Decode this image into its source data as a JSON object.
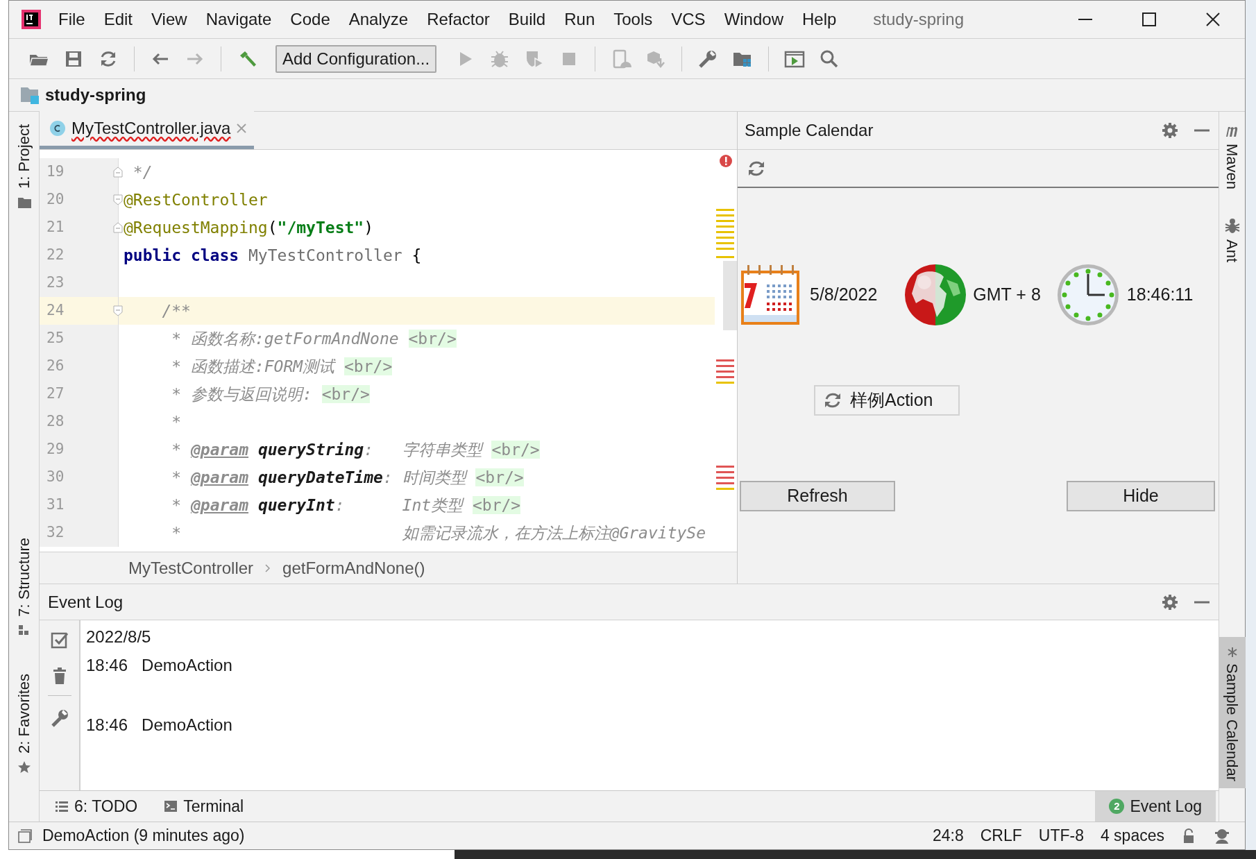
{
  "title_bar": {
    "menu": [
      "File",
      "Edit",
      "View",
      "Navigate",
      "Code",
      "Analyze",
      "Refactor",
      "Build",
      "Run",
      "Tools",
      "VCS",
      "Window",
      "Help"
    ],
    "title": "study-spring"
  },
  "toolbar": {
    "file_buttons": [
      {
        "disabled": false
      },
      {
        "disabled": false
      },
      {
        "disabled": false
      }
    ],
    "history_buttons": [
      {
        "disabled": false
      },
      {
        "disabled": true
      }
    ],
    "build_button": {
      "disabled": false
    },
    "run_configuration": "Add Configuration...",
    "run_buttons": [
      {
        "disabled": true
      },
      {
        "disabled": true
      },
      {
        "disabled": true
      },
      {
        "disabled": true
      }
    ],
    "device_buttons": [
      {
        "disabled": true
      },
      {
        "disabled": true
      }
    ],
    "settings_buttons": [
      {
        "disabled": false
      },
      {
        "disabled": false
      }
    ],
    "misc_buttons": [
      {
        "disabled": false
      },
      {
        "disabled": false
      }
    ]
  },
  "nav_bar": {
    "project": "study-spring"
  },
  "left_tool_strip": [
    {
      "label": "1: Project",
      "selected": false
    },
    {
      "label": "7: Structure",
      "selected": false
    },
    {
      "label": "2: Favorites",
      "selected": false
    }
  ],
  "editor": {
    "tabs": [
      {
        "label": "MyTestController.java",
        "selected": true,
        "error": true
      }
    ],
    "has_errors": true,
    "lines": [
      {
        "number": "19",
        "current": false,
        "fold_start": false,
        "fold_end": true,
        "segments": [
          {
            "kind": "comment",
            "text": " */"
          }
        ]
      },
      {
        "number": "20",
        "current": false,
        "fold_start": true,
        "fold_end": false,
        "segments": [
          {
            "kind": "annotation",
            "text": "@RestController"
          }
        ]
      },
      {
        "number": "21",
        "current": false,
        "fold_start": false,
        "fold_end": true,
        "segments": [
          {
            "kind": "annotation",
            "text": "@RequestMapping"
          },
          {
            "kind": "plain",
            "text": "("
          },
          {
            "kind": "string",
            "text": "\"/myTest\""
          },
          {
            "kind": "plain",
            "text": ")"
          }
        ]
      },
      {
        "number": "22",
        "current": false,
        "segments": [
          {
            "kind": "keyword",
            "text": "public class "
          },
          {
            "kind": "classname",
            "text": "MyTestController"
          },
          {
            "kind": "plain",
            "text": " {"
          }
        ]
      },
      {
        "number": "23",
        "current": false
      },
      {
        "number": "24",
        "current": true,
        "fold_start": true,
        "fold_end": false,
        "segments": [
          {
            "kind": "comment",
            "text": "    /**"
          }
        ]
      },
      {
        "number": "25",
        "current": false,
        "segments": [
          {
            "kind": "doc",
            "text": "     * 函数名称:getFormAndNone "
          },
          {
            "kind": "tag",
            "text": "<br/>"
          }
        ]
      },
      {
        "number": "26",
        "current": false,
        "segments": [
          {
            "kind": "doc",
            "text": "     * 函数描述:FORM测试 "
          },
          {
            "kind": "tag",
            "text": "<br/>"
          }
        ]
      },
      {
        "number": "27",
        "current": false,
        "segments": [
          {
            "kind": "doc",
            "text": "     * 参数与返回说明: "
          },
          {
            "kind": "tag",
            "text": "<br/>"
          }
        ]
      },
      {
        "number": "28",
        "current": false,
        "segments": [
          {
            "kind": "doc",
            "text": "     *"
          }
        ]
      },
      {
        "number": "29",
        "current": false,
        "segments": [
          {
            "kind": "doc",
            "text": "     * "
          },
          {
            "kind": "param_tag",
            "text": "@param"
          },
          {
            "kind": "param_name",
            "text": " queryString"
          },
          {
            "kind": "doc",
            "text": ":   字符串类型 "
          },
          {
            "kind": "tag",
            "text": "<br/>"
          }
        ]
      },
      {
        "number": "30",
        "current": false,
        "segments": [
          {
            "kind": "doc",
            "text": "     * "
          },
          {
            "kind": "param_tag",
            "text": "@param"
          },
          {
            "kind": "param_name",
            "text": " queryDateTime"
          },
          {
            "kind": "doc",
            "text": ": 时间类型 "
          },
          {
            "kind": "tag",
            "text": "<br/>"
          }
        ]
      },
      {
        "number": "31",
        "current": false,
        "segments": [
          {
            "kind": "doc",
            "text": "     * "
          },
          {
            "kind": "param_tag",
            "text": "@param"
          },
          {
            "kind": "param_name",
            "text": " queryInt"
          },
          {
            "kind": "doc",
            "text": ":      Int类型 "
          },
          {
            "kind": "tag",
            "text": "<br/>"
          }
        ]
      },
      {
        "number": "32",
        "current": false,
        "segments": [
          {
            "kind": "doc",
            "text": "     *                       如需记录流水，在方法上标注@GravitySe"
          }
        ]
      }
    ],
    "breadcrumbs": [
      "MyTestController",
      "getFormAndNone()"
    ]
  },
  "calendar_panel": {
    "title": "Sample Calendar",
    "date": "5/8/2022",
    "timezone": "GMT + 8",
    "time": "18:46:11",
    "action_button": "样例Action",
    "buttons": [
      "Refresh",
      "Hide"
    ]
  },
  "event_log": {
    "title": "Event Log",
    "groups": [
      {
        "date": "2022/8/5",
        "entries": [
          {
            "time": "18:46",
            "message": "DemoAction"
          },
          {
            "time": "18:46",
            "message": "DemoAction"
          }
        ]
      }
    ]
  },
  "right_tool_strip": [
    {
      "label": "Maven",
      "selected": false
    },
    {
      "label": "Ant",
      "selected": false
    },
    {
      "label": "Sample Calendar",
      "selected": true
    }
  ],
  "bottom_tabs": [
    {
      "label": "6: TODO",
      "selected": false
    },
    {
      "label": "Terminal",
      "selected": false
    },
    {
      "label": "Event Log",
      "badge": "2",
      "selected": true
    }
  ],
  "status_bar": {
    "message": "DemoAction (9 minutes ago)",
    "items": [
      "24:8",
      "CRLF",
      "UTF-8",
      "4 spaces"
    ]
  }
}
